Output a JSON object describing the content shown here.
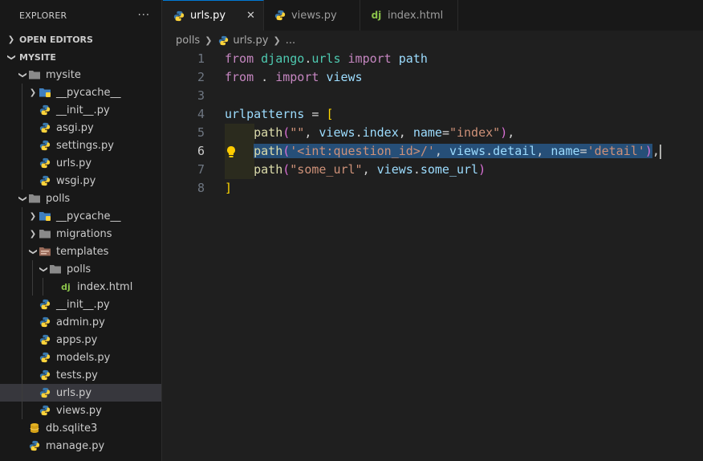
{
  "explorer": {
    "title": "EXPLORER",
    "more": "···",
    "open_editors": "OPEN EDITORS",
    "workspace": "MYSITE",
    "tree": [
      {
        "label": "mysite",
        "depth": 1,
        "type": "folder",
        "expanded": true
      },
      {
        "label": "__pycache__",
        "depth": 2,
        "type": "pycache",
        "expanded": false
      },
      {
        "label": "__init__.py",
        "depth": 2,
        "type": "py"
      },
      {
        "label": "asgi.py",
        "depth": 2,
        "type": "py"
      },
      {
        "label": "settings.py",
        "depth": 2,
        "type": "py"
      },
      {
        "label": "urls.py",
        "depth": 2,
        "type": "py"
      },
      {
        "label": "wsgi.py",
        "depth": 2,
        "type": "py"
      },
      {
        "label": "polls",
        "depth": 1,
        "type": "folder",
        "expanded": true
      },
      {
        "label": "__pycache__",
        "depth": 2,
        "type": "pycache",
        "expanded": false
      },
      {
        "label": "migrations",
        "depth": 2,
        "type": "folder",
        "expanded": false
      },
      {
        "label": "templates",
        "depth": 2,
        "type": "templates",
        "expanded": true
      },
      {
        "label": "polls",
        "depth": 3,
        "type": "folder",
        "expanded": true
      },
      {
        "label": "index.html",
        "depth": 4,
        "type": "django"
      },
      {
        "label": "__init__.py",
        "depth": 2,
        "type": "py"
      },
      {
        "label": "admin.py",
        "depth": 2,
        "type": "py"
      },
      {
        "label": "apps.py",
        "depth": 2,
        "type": "py"
      },
      {
        "label": "models.py",
        "depth": 2,
        "type": "py"
      },
      {
        "label": "tests.py",
        "depth": 2,
        "type": "py"
      },
      {
        "label": "urls.py",
        "depth": 2,
        "type": "py",
        "selected": true
      },
      {
        "label": "views.py",
        "depth": 2,
        "type": "py"
      },
      {
        "label": "db.sqlite3",
        "depth": 1,
        "type": "db"
      },
      {
        "label": "manage.py",
        "depth": 1,
        "type": "py"
      }
    ]
  },
  "tabs": [
    {
      "label": "urls.py",
      "icon": "python-icon",
      "active": true,
      "close": "✕"
    },
    {
      "label": "views.py",
      "icon": "python-icon",
      "active": false
    },
    {
      "label": "index.html",
      "icon": "django-icon",
      "active": false
    }
  ],
  "breadcrumb": {
    "folder": "polls",
    "file": "urls.py",
    "more": "..."
  },
  "editor": {
    "current_line": 6,
    "lines": [
      {
        "n": "1",
        "tokens": [
          [
            "from",
            "kw"
          ],
          [
            " ",
            ""
          ],
          [
            "django",
            "mod"
          ],
          [
            ".",
            "op"
          ],
          [
            "urls",
            "mod"
          ],
          [
            " ",
            ""
          ],
          [
            "import",
            "kw"
          ],
          [
            " ",
            ""
          ],
          [
            "path",
            "var"
          ]
        ]
      },
      {
        "n": "2",
        "tokens": [
          [
            "from",
            "kw"
          ],
          [
            " . ",
            "op"
          ],
          [
            "import",
            "kw"
          ],
          [
            " ",
            ""
          ],
          [
            "views",
            "var"
          ]
        ]
      },
      {
        "n": "3",
        "tokens": []
      },
      {
        "n": "4",
        "tokens": [
          [
            "urlpatterns",
            "var"
          ],
          [
            " = ",
            "op"
          ],
          [
            "[",
            "br"
          ]
        ]
      },
      {
        "n": "5",
        "tokens": [
          [
            "    ",
            ""
          ],
          [
            "path",
            "fn"
          ],
          [
            "(",
            "br2"
          ],
          [
            "\"\"",
            "str"
          ],
          [
            ", ",
            "op"
          ],
          [
            "views",
            "var"
          ],
          [
            ".",
            "op"
          ],
          [
            "index",
            "var"
          ],
          [
            ", ",
            "op"
          ],
          [
            "name",
            "var"
          ],
          [
            "=",
            "op"
          ],
          [
            "\"index\"",
            "str"
          ],
          [
            ")",
            "br2"
          ],
          [
            ",",
            "op"
          ]
        ]
      },
      {
        "n": "6",
        "tokens": [
          [
            "    ",
            ""
          ],
          [
            "path",
            "fn",
            "sel"
          ],
          [
            "(",
            "br2",
            "sel"
          ],
          [
            "'<int:question_id>/'",
            "str",
            "sel"
          ],
          [
            ", ",
            "op",
            "sel"
          ],
          [
            "views",
            "var",
            "sel"
          ],
          [
            ".",
            "op",
            "sel"
          ],
          [
            "detail",
            "var",
            "sel"
          ],
          [
            ", ",
            "op",
            "sel"
          ],
          [
            "name",
            "var",
            "sel"
          ],
          [
            "=",
            "op",
            "sel"
          ],
          [
            "'detail'",
            "str",
            "sel"
          ],
          [
            ")",
            "br2",
            "sel"
          ],
          [
            ",",
            "op"
          ]
        ]
      },
      {
        "n": "7",
        "tokens": [
          [
            "    ",
            ""
          ],
          [
            "path",
            "fn"
          ],
          [
            "(",
            "br2"
          ],
          [
            "\"some_url\"",
            "str"
          ],
          [
            ", ",
            "op"
          ],
          [
            "views",
            "var"
          ],
          [
            ".",
            "op"
          ],
          [
            "some_url",
            "var"
          ],
          [
            ")",
            "br2"
          ]
        ]
      },
      {
        "n": "8",
        "tokens": [
          [
            "]",
            "br"
          ]
        ]
      }
    ]
  },
  "colors": {
    "accent": "#0078d4",
    "selection": "#264f78",
    "python_blue": "#3776ab",
    "python_yellow": "#ffd43b",
    "django": "#8bc34a",
    "bulb": "#ffcc00"
  }
}
